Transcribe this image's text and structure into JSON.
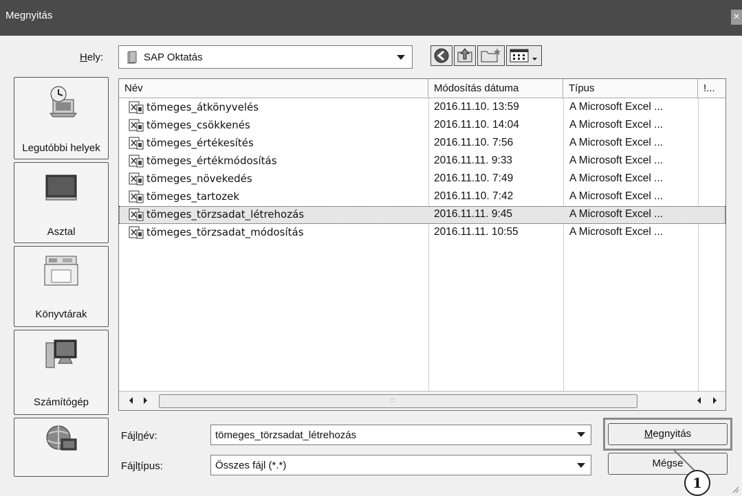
{
  "window": {
    "title": "Megnyitás",
    "close_label": "×"
  },
  "location": {
    "label_hotkey": "H",
    "label_rest": "ely:",
    "value": "SAP Oktatás"
  },
  "toolbar": {
    "icons": [
      "back-icon",
      "up-folder-icon",
      "new-folder-icon",
      "view-menu-icon"
    ]
  },
  "places": [
    {
      "label": "Legutóbbi helyek",
      "icon": "recent-places-icon"
    },
    {
      "label": "Asztal",
      "icon": "desktop-icon"
    },
    {
      "label": "Könyvtárak",
      "icon": "libraries-icon"
    },
    {
      "label": "Számítógép",
      "icon": "computer-icon"
    },
    {
      "label": "",
      "icon": "network-icon"
    }
  ],
  "file_list": {
    "columns": [
      "Név",
      "Módosítás dátuma",
      "Típus",
      "!..."
    ],
    "rows": [
      {
        "name": "tömeges_átkönyvelés",
        "date": "2016.11.10. 13:59",
        "type": "A Microsoft Excel ...",
        "selected": false
      },
      {
        "name": "tömeges_csökkenés",
        "date": "2016.11.10. 14:04",
        "type": "A Microsoft Excel ...",
        "selected": false
      },
      {
        "name": "tömeges_értékesítés",
        "date": "2016.11.10. 7:56",
        "type": "A Microsoft Excel ...",
        "selected": false
      },
      {
        "name": "tömeges_értékmódosítás",
        "date": "2016.11.11. 9:33",
        "type": "A Microsoft Excel ...",
        "selected": false
      },
      {
        "name": "tömeges_növekedés",
        "date": "2016.11.10. 7:49",
        "type": "A Microsoft Excel ...",
        "selected": false
      },
      {
        "name": "tömeges_tartozek",
        "date": "2016.11.10. 7:42",
        "type": "A Microsoft Excel ...",
        "selected": false
      },
      {
        "name": "tömeges_törzsadat_létrehozás",
        "date": "2016.11.11. 9:45",
        "type": "A Microsoft Excel ...",
        "selected": true
      },
      {
        "name": "tömeges_törzsadat_módosítás",
        "date": "2016.11.11. 10:55",
        "type": "A Microsoft Excel ...",
        "selected": false
      }
    ],
    "scroll_grip": ":::"
  },
  "filename": {
    "label_pre": "Fájl",
    "label_hotkey": "n",
    "label_rest": "év:",
    "value": "tömeges_törzsadat_létrehozás"
  },
  "filetype": {
    "label_pre": "Fájl",
    "label_hotkey": "t",
    "label_rest": "ípus:",
    "value": "Összes fájl (*.*)"
  },
  "buttons": {
    "open_hotkey": "M",
    "open_rest": "egnyitás",
    "cancel": "Mégse"
  },
  "annotation": {
    "callout_number": "1"
  }
}
